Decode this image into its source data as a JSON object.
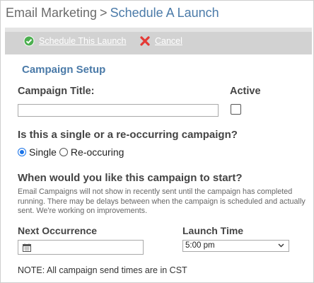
{
  "breadcrumb": {
    "root": "Email Marketing",
    "separator": ">",
    "current": "Schedule A Launch"
  },
  "toolbar": {
    "schedule_label": "Schedule This Launch",
    "cancel_label": "Cancel",
    "schedule_icon": "check-circle-icon",
    "cancel_icon": "x-icon"
  },
  "form": {
    "section_title": "Campaign Setup",
    "campaign_title_label": "Campaign Title:",
    "campaign_title_value": "",
    "active_label": "Active",
    "active_checked": false,
    "type_question": "Is this a single or a re-occurring campaign?",
    "type_options": [
      "Single",
      "Re-occuring"
    ],
    "type_selected": "Single",
    "start_question": "When would you like this campaign to start?",
    "start_help": "Email Campaigns will not show in recently sent until the campaign has completed running. There may be delays between when the campaign is scheduled and actually sent. We're working on improvements.",
    "next_occurrence_label": "Next Occurrence",
    "next_occurrence_value": "",
    "launch_time_label": "Launch Time",
    "launch_time_value": "5:00 pm",
    "note": "NOTE: All campaign send times are in CST"
  },
  "colors": {
    "accent": "#4a7aa8",
    "toolbar_bg": "#d2d2d2",
    "check_green": "#4caf50",
    "cancel_red": "#e53935"
  }
}
